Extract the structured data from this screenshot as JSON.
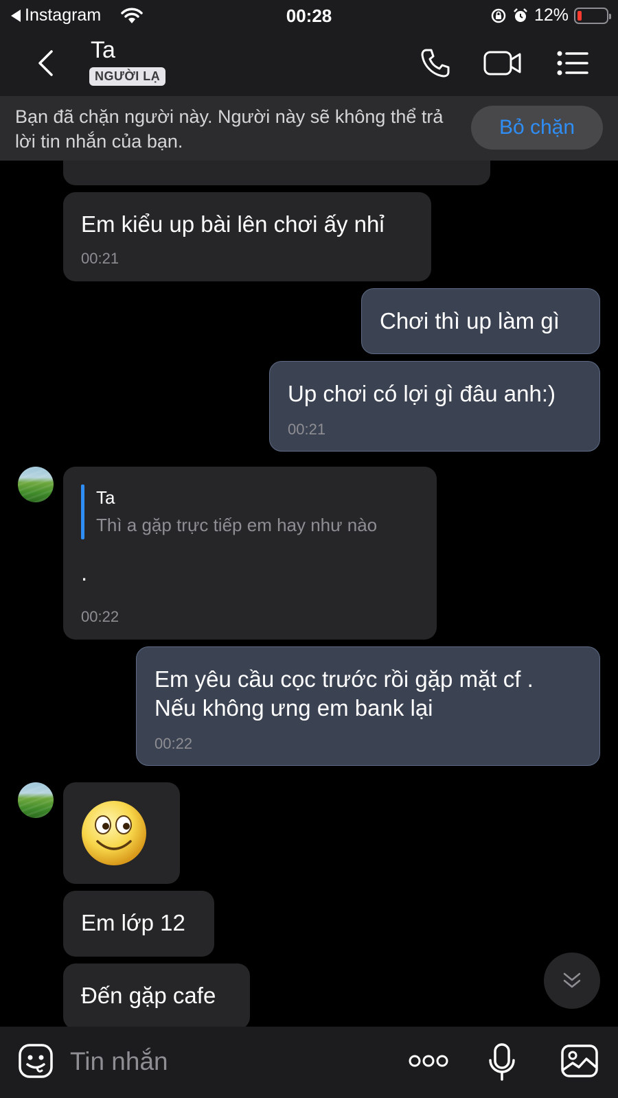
{
  "status_bar": {
    "back_app": "Instagram",
    "time": "00:28",
    "battery": "12%"
  },
  "header": {
    "name": "Ta",
    "badge": "NGƯỜI LẠ"
  },
  "banner": {
    "text": "Bạn đã chặn người này. Người này sẽ không thể trả lời tin nhắn của bạn.",
    "unblock_label": "Bỏ chặn"
  },
  "messages": [
    {
      "side": "in",
      "text": "Em kiểu up bài lên chơi ấy nhỉ",
      "time": "00:21"
    },
    {
      "side": "out",
      "text": "Chơi thì up làm gì"
    },
    {
      "side": "out",
      "text": "Up chơi có lợi gì đâu anh:)",
      "time": "00:21"
    },
    {
      "side": "in",
      "quote_name": "Ta",
      "quote_text": "Thì a gặp trực tiếp em hay như nào",
      "text": ".",
      "time": "00:22"
    },
    {
      "side": "out",
      "lines": [
        "Em yêu cầu cọc trước rồi gặp mặt cf .",
        "Nếu không ưng em bank lại"
      ],
      "time": "00:22"
    },
    {
      "side": "in",
      "sticker": "smiley-emoji"
    },
    {
      "side": "in",
      "text": "Em lớp 12"
    },
    {
      "side": "in",
      "text": "Đến gặp cafe"
    }
  ],
  "composer": {
    "placeholder": "Tin nhắn"
  },
  "colors": {
    "accent": "#2f8ef5",
    "incoming_bubble": "#262628",
    "outgoing_bubble": "#3b4252",
    "bar_bg": "#1c1c1e"
  },
  "icons": [
    "wifi-icon",
    "rotation-lock-icon",
    "alarm-icon",
    "battery-icon",
    "back-chevron-icon",
    "phone-icon",
    "video-camera-icon",
    "menu-list-icon",
    "scroll-down-icon",
    "sticker-icon",
    "more-icon",
    "microphone-icon",
    "image-icon"
  ]
}
